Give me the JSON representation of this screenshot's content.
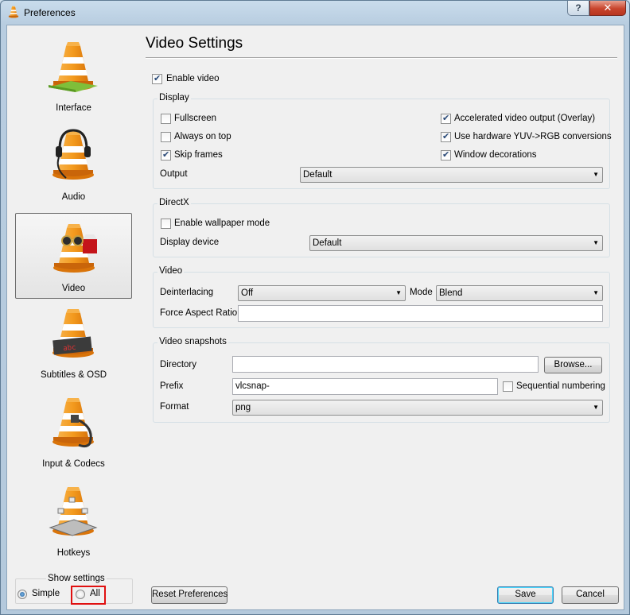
{
  "window": {
    "title": "Preferences",
    "help_label": "?",
    "close_label": "✕"
  },
  "sidebar": {
    "items": [
      {
        "label": "Interface",
        "icon": "vlc-cone-interface-icon"
      },
      {
        "label": "Audio",
        "icon": "vlc-cone-headphones-icon"
      },
      {
        "label": "Video",
        "icon": "vlc-cone-glasses-icon",
        "selected": true
      },
      {
        "label": "Subtitles & OSD",
        "icon": "vlc-cone-subtitles-icon"
      },
      {
        "label": "Input & Codecs",
        "icon": "vlc-cone-cable-icon"
      },
      {
        "label": "Hotkeys",
        "icon": "vlc-cone-keyboard-icon"
      }
    ],
    "show_settings": {
      "title": "Show settings",
      "simple_label": "Simple",
      "all_label": "All",
      "selected": "Simple"
    }
  },
  "panel": {
    "title": "Video Settings",
    "enable_video": {
      "label": "Enable video",
      "checked": true
    },
    "display": {
      "title": "Display",
      "fullscreen": {
        "label": "Fullscreen",
        "checked": false
      },
      "always_on_top": {
        "label": "Always on top",
        "checked": false
      },
      "skip_frames": {
        "label": "Skip frames",
        "checked": true
      },
      "accelerated": {
        "label": "Accelerated video output (Overlay)",
        "checked": true
      },
      "hw_yuv": {
        "label": "Use hardware YUV->RGB conversions",
        "checked": true
      },
      "window_decorations": {
        "label": "Window decorations",
        "checked": true
      },
      "output_label": "Output",
      "output_value": "Default"
    },
    "directx": {
      "title": "DirectX",
      "wallpaper": {
        "label": "Enable wallpaper mode",
        "checked": false
      },
      "display_device_label": "Display device",
      "display_device_value": "Default"
    },
    "video": {
      "title": "Video",
      "deinterlacing_label": "Deinterlacing",
      "deinterlacing_value": "Off",
      "mode_label": "Mode",
      "mode_value": "Blend",
      "aspect_label": "Force Aspect Ratio",
      "aspect_value": ""
    },
    "snapshots": {
      "title": "Video snapshots",
      "directory_label": "Directory",
      "directory_value": "",
      "browse_label": "Browse...",
      "prefix_label": "Prefix",
      "prefix_value": "vlcsnap-",
      "sequential": {
        "label": "Sequential numbering",
        "checked": false
      },
      "format_label": "Format",
      "format_value": "png"
    }
  },
  "footer": {
    "reset_label": "Reset Preferences",
    "save_label": "Save",
    "cancel_label": "Cancel"
  },
  "colors": {
    "cone_orange": "#f39a1e",
    "cone_white": "#ffffff",
    "highlight_red": "#e01010",
    "default_button_border": "#3c7fb1"
  }
}
